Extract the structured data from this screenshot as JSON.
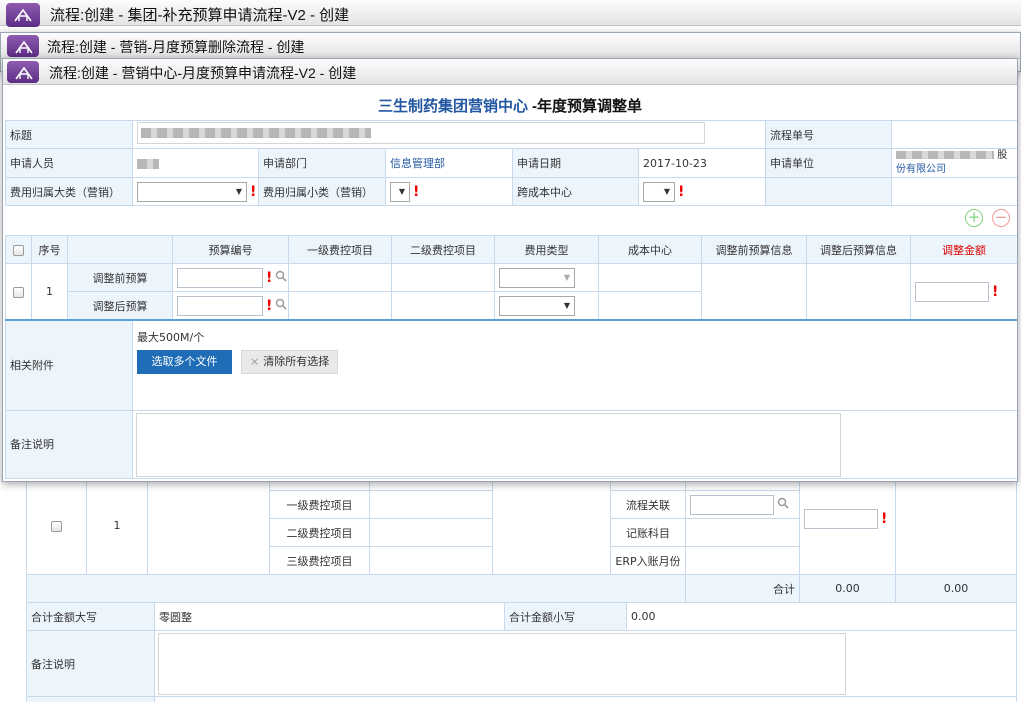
{
  "windows": [
    {
      "title": "流程:创建 - 集团-补充预算申请流程-V2 - 创建"
    },
    {
      "title": "流程:创建 - 营销-月度预算删除流程 - 创建"
    },
    {
      "title": "流程:创建 - 营销中心-月度预算申请流程-V2 - 创建"
    }
  ],
  "form": {
    "title_org": "三生制药集团营销中心",
    "title_doc": "-年度预算调整单",
    "labels": {
      "subject": "标题",
      "flow_no": "流程单号",
      "applicant": "申请人员",
      "dept": "申请部门",
      "date": "申请日期",
      "unit": "申请单位",
      "cat_big": "费用归属大类（营销）",
      "cat_small": "费用归属小类（营销）",
      "cross_cc": "跨成本中心"
    },
    "values": {
      "dept": "信息管理部",
      "date": "2017-10-23",
      "unit_suffix_1": "股",
      "unit_suffix_2": "份有限公司"
    },
    "table": {
      "headers": [
        "序号",
        "预算编号",
        "一级费控项目",
        "二级费控项目",
        "费用类型",
        "成本中心",
        "调整前预算信息",
        "调整后预算信息",
        "调整金额"
      ],
      "row_no": "1",
      "row_before": "调整前预算",
      "row_after": "调整后预算"
    },
    "attach": {
      "label": "相关附件",
      "max": "最大500M/个",
      "select_btn": "选取多个文件",
      "clear_btn": "清除所有选择"
    },
    "remark_label": "备注说明",
    "add_icon": "plus-circle-icon",
    "remove_icon": "minus-circle-icon"
  },
  "bg": {
    "row_no": "1",
    "ctrl_1": "一级费控项目",
    "ctrl_2": "二级费控项目",
    "ctrl_3": "三级费控项目",
    "flow_link": "流程关联",
    "account": "记账科目",
    "erp_month": "ERP入账月份",
    "total_label": "合计",
    "total_1": "0.00",
    "total_2": "0.00",
    "amount_upper_label": "合计金额大写",
    "amount_upper": "零圆整",
    "amount_lower_label": "合计金额小写",
    "amount_lower": "0.00",
    "remark_label": "备注说明"
  },
  "colors": {
    "accent": "#1f6db7",
    "title_blue": "#2457a2",
    "required": "#e00000",
    "label_bg": "#edf5fc"
  }
}
